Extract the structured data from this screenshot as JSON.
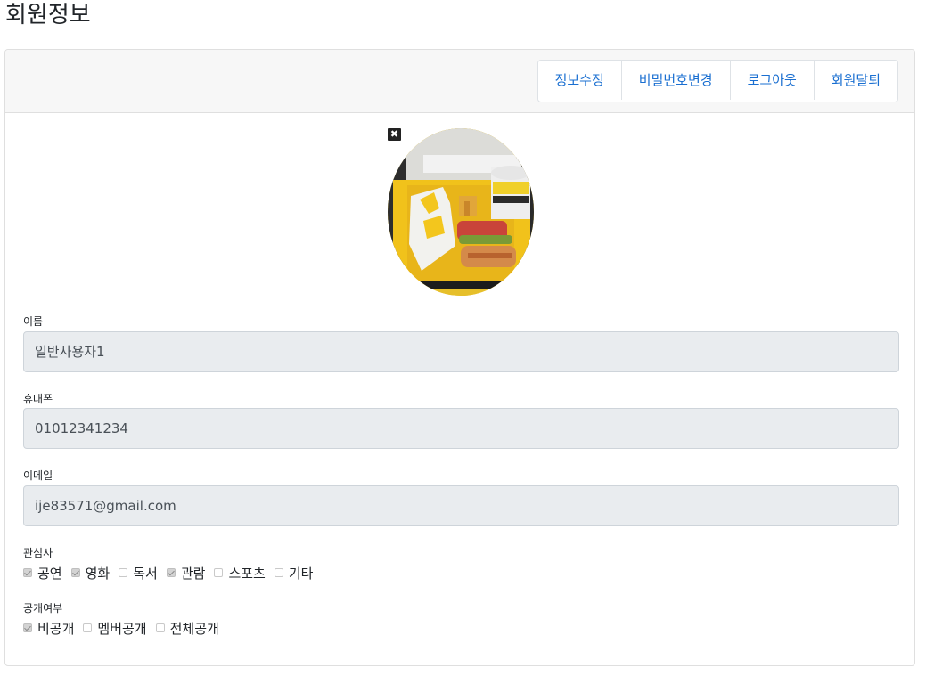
{
  "page": {
    "title": "회원정보"
  },
  "header": {
    "buttons": [
      {
        "label": "정보수정"
      },
      {
        "label": "비밀번호변경"
      },
      {
        "label": "로그아웃"
      },
      {
        "label": "회원탈퇴"
      }
    ]
  },
  "profile": {
    "remove_icon": "close-icon",
    "remove_glyph": "✖"
  },
  "fields": {
    "name": {
      "label": "이름",
      "value": "일반사용자1"
    },
    "phone": {
      "label": "휴대폰",
      "value": "01012341234"
    },
    "email": {
      "label": "이메일",
      "value": "ije83571@gmail.com"
    }
  },
  "interests": {
    "label": "관심사",
    "options": [
      {
        "label": "공연",
        "checked": true
      },
      {
        "label": "영화",
        "checked": true
      },
      {
        "label": "독서",
        "checked": false
      },
      {
        "label": "관람",
        "checked": true
      },
      {
        "label": "스포츠",
        "checked": false
      },
      {
        "label": "기타",
        "checked": false
      }
    ]
  },
  "visibility": {
    "label": "공개여부",
    "options": [
      {
        "label": "비공개",
        "checked": true
      },
      {
        "label": "멤버공개",
        "checked": false
      },
      {
        "label": "전체공개",
        "checked": false
      }
    ]
  }
}
